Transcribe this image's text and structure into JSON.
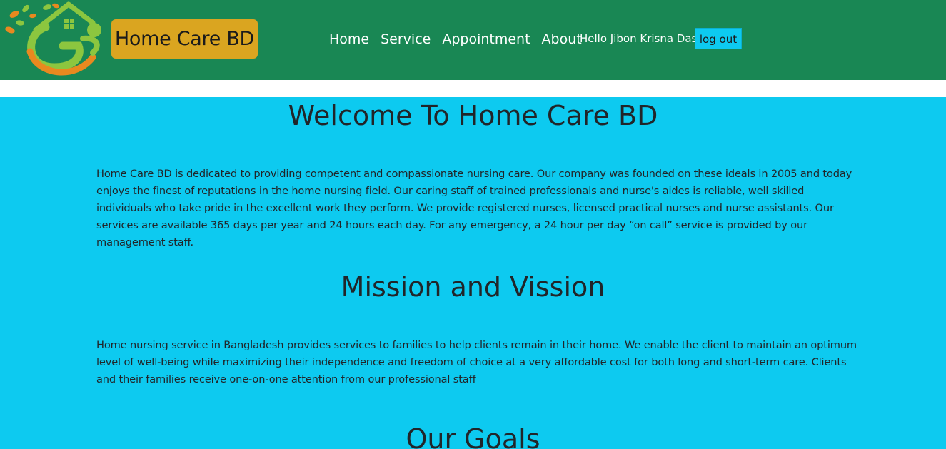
{
  "header": {
    "brand": "Home Care BD",
    "nav": [
      "Home",
      "Service",
      "Appointment",
      "About"
    ],
    "greeting": "Hello Jibon Krisna Das",
    "logout_label": "log out"
  },
  "main": {
    "welcome_title": "Welcome To Home Care BD",
    "welcome_text": "Home Care BD is dedicated to providing competent and compassionate nursing care. Our company was founded on these ideals in 2005 and today enjoys the finest of reputations in the home nursing field. Our caring staff of trained professionals and nurse's aides is reliable, well skilled individuals who take pride in the excellent work they perform. We provide registered nurses, licensed practical nurses and nurse assistants. Our services are available 365 days per year and 24 hours each day. For any emergency, a 24 hour per day “on call” service is provided by our management staff.",
    "mission_title": "Mission and Vission",
    "mission_text": "Home nursing service in Bangladesh provides services to families to help clients remain in their home. We enable the client to maintain an optimum level of well-being while maximizing their independence and freedom of choice at a very affordable cost for both long and short-term care. Clients and their families receive one-on-one attention from our professional staff",
    "goals_title": "Our Goals"
  },
  "colors": {
    "navbar": "#198754",
    "brand_bg": "#daa520",
    "main_bg": "#0dcaf0",
    "logout_bg": "#0dcaf0"
  },
  "icons": {
    "logo": "home-care-logo-icon"
  }
}
